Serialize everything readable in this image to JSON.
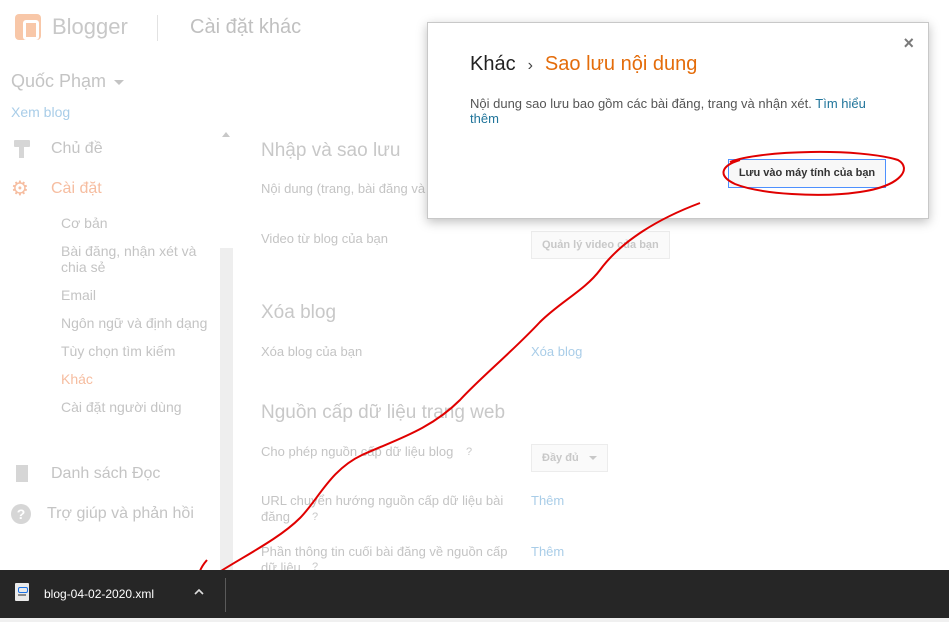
{
  "header": {
    "brand": "Blogger",
    "page_title": "Cài đặt khác"
  },
  "sidebar": {
    "user": "Quốc Phạm",
    "view_blog": "Xem blog",
    "nav": [
      {
        "label": "Chủ đề",
        "icon": "paint-roller-icon"
      },
      {
        "label": "Cài đặt",
        "icon": "gear-icon",
        "active": true
      },
      {
        "label": "Danh sách Đọc",
        "icon": "bookmark-icon"
      },
      {
        "label": "Trợ giúp và phản hồi",
        "icon": "help-icon"
      }
    ],
    "settings_sub": [
      "Cơ bản",
      "Bài đăng, nhận xét và chia sẻ",
      "Email",
      "Ngôn ngữ và định dạng",
      "Tùy chọn tìm kiếm",
      "Khác",
      "Cài đặt người dùng"
    ],
    "active_sub": "Khác"
  },
  "main": {
    "import_backup": {
      "title": "Nhập và sao lưu",
      "content_label": "Nội dung (trang, bài đăng và",
      "video_label": "Video từ blog của bạn",
      "video_button": "Quản lý video của bạn"
    },
    "delete_blog": {
      "title": "Xóa blog",
      "label": "Xóa blog của bạn",
      "link": "Xóa blog"
    },
    "feed": {
      "title": "Nguồn cấp dữ liệu trang web",
      "allow_label": "Cho phép nguồn cấp dữ liệu blog",
      "allow_value": "Đầy đủ",
      "redirect_label": "URL chuyển hướng nguồn cấp dữ liệu bài đăng",
      "redirect_link": "Thêm",
      "footer_label": "Phần thông tin cuối bài đăng về nguồn cấp dữ liệu",
      "footer_link": "Thêm",
      "help_mark": "?"
    }
  },
  "dialog": {
    "crumb_root": "Khác",
    "crumb_sep": "›",
    "crumb_current": "Sao lưu nội dung",
    "body_text": "Nội dung sao lưu bao gồm các bài đăng, trang và nhận xét.",
    "learn_more": "Tìm hiểu thêm",
    "save_button": "Lưu vào máy tính của bạn",
    "close": "×"
  },
  "download_bar": {
    "file_name": "blog-04-02-2020.xml"
  },
  "colors": {
    "accent_orange": "#e46c0a",
    "link_blue": "#21759b",
    "annotation_red": "#e00000",
    "download_bar": "#262626"
  }
}
